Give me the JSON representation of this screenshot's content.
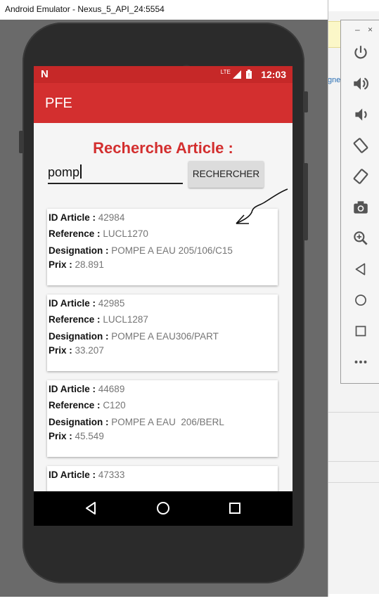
{
  "window": {
    "title": "Android Emulator - Nexus_5_API_24:5554",
    "minimize": "–",
    "close": "×"
  },
  "background": {
    "partial_text": "gne"
  },
  "statusbar": {
    "carrier_icon": "N",
    "network": "LTE",
    "time": "12:03"
  },
  "app": {
    "title": "PFE",
    "heading": "Recherche Article :",
    "search": {
      "value": "pomp",
      "button_label": "RECHERCHER"
    },
    "labels": {
      "id": "ID Article :",
      "reference": "Reference :",
      "designation": "Designation :",
      "price": "Prix :"
    },
    "articles": [
      {
        "id": "42984",
        "reference": "LUCL1270",
        "designation": "POMPE A EAU 205/106/C15",
        "price": "28.891"
      },
      {
        "id": "42985",
        "reference": "LUCL1287",
        "designation": "POMPE A EAU306/PART",
        "price": "33.207"
      },
      {
        "id": "44689",
        "reference": "C120",
        "designation": "POMPE A EAU  206/BERL",
        "price": "45.549"
      },
      {
        "id": "47333"
      }
    ]
  },
  "navbar": {
    "icons": [
      "back-triangle",
      "home-circle",
      "recents-square"
    ]
  },
  "toolbar": {
    "icons": [
      "power",
      "volume-up",
      "volume-down",
      "rotate-left",
      "rotate-right",
      "camera",
      "zoom",
      "back",
      "home",
      "overview",
      "more"
    ]
  },
  "colors": {
    "primary": "#d32f2f",
    "primary_dark": "#c62828",
    "value_text": "#757575"
  }
}
